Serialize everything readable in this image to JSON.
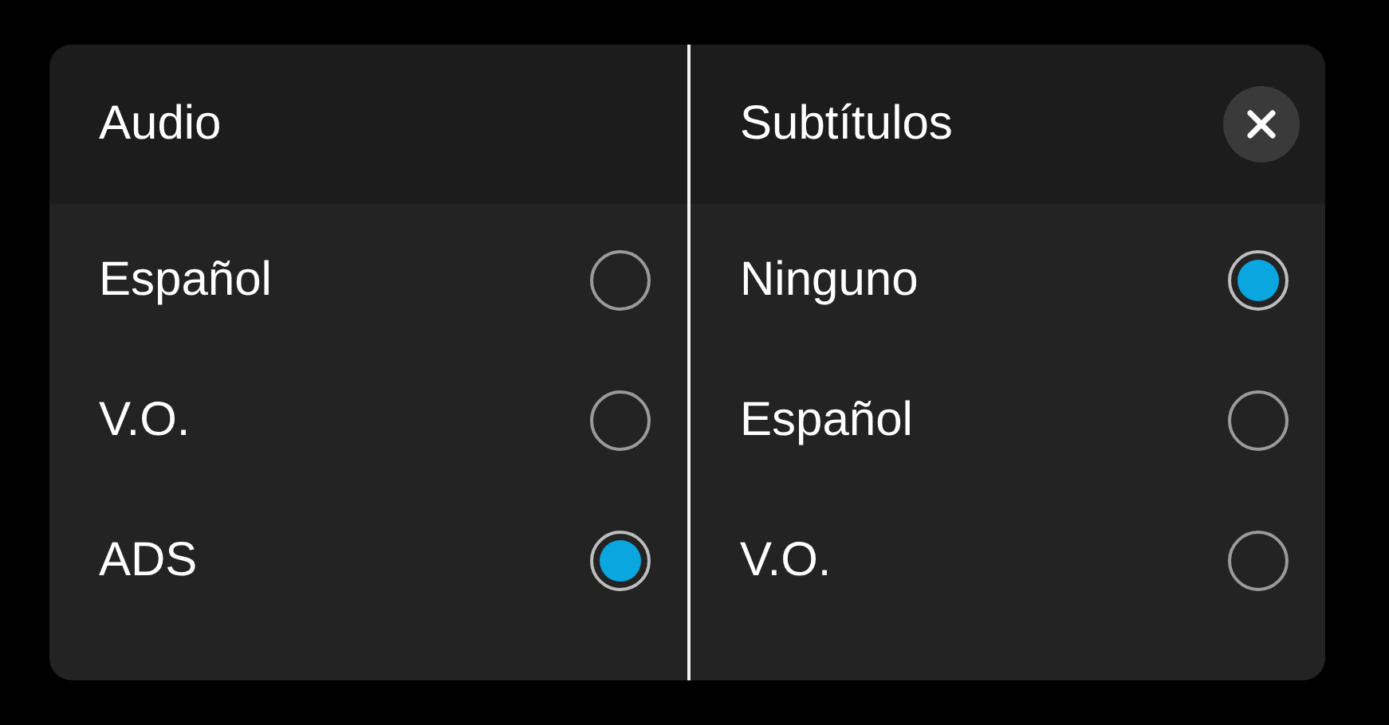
{
  "panels": [
    {
      "title": "Audio",
      "close_button": false,
      "options": [
        {
          "label": "Español",
          "selected": false
        },
        {
          "label": "V.O.",
          "selected": false
        },
        {
          "label": "ADS",
          "selected": true
        }
      ]
    },
    {
      "title": "Subtítulos",
      "close_button": true,
      "options": [
        {
          "label": "Ninguno",
          "selected": true
        },
        {
          "label": "Español",
          "selected": false
        },
        {
          "label": "V.O.",
          "selected": false
        }
      ]
    }
  ]
}
